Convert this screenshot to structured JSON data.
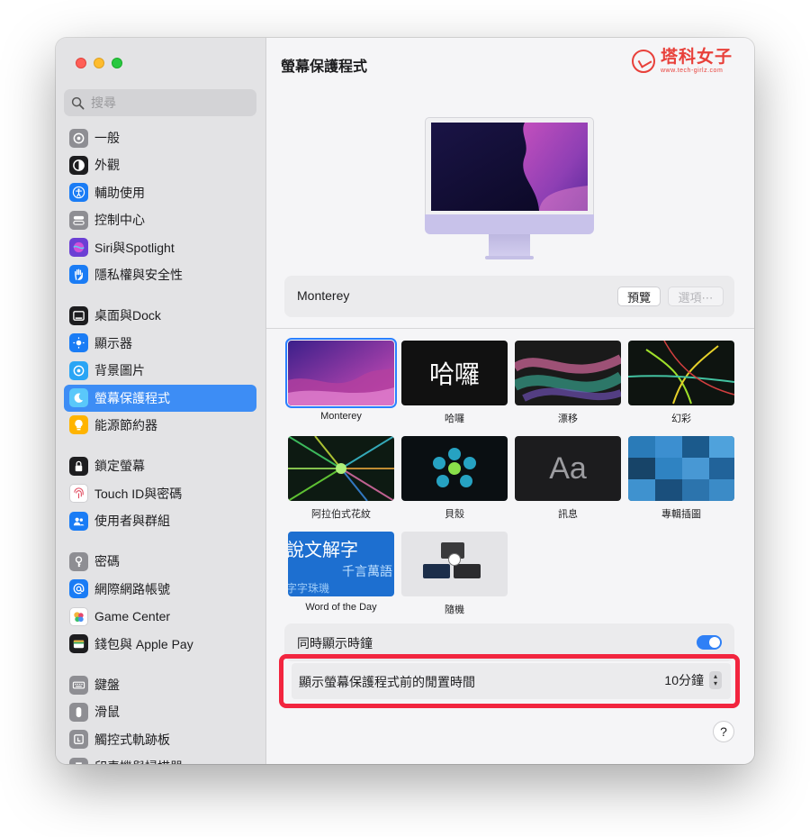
{
  "window": {
    "controls": [
      "close",
      "minimize",
      "zoom"
    ]
  },
  "sidebar": {
    "search_placeholder": "搜尋",
    "groups": [
      [
        {
          "label": "一般",
          "icon": "gear-icon",
          "color": "#8e8e93"
        },
        {
          "label": "外觀",
          "icon": "appearance-icon",
          "color": "#1d1d1f"
        },
        {
          "label": "輔助使用",
          "icon": "accessibility-icon",
          "color": "#1a7cf5"
        },
        {
          "label": "控制中心",
          "icon": "control-center-icon",
          "color": "#8e8e93"
        },
        {
          "label": "Siri與Spotlight",
          "icon": "siri-icon",
          "color": "#6b3fd4"
        },
        {
          "label": "隱私權與安全性",
          "icon": "hand-icon",
          "color": "#1a7cf5"
        }
      ],
      [
        {
          "label": "桌面與Dock",
          "icon": "dock-icon",
          "color": "#1d1d1f"
        },
        {
          "label": "顯示器",
          "icon": "display-icon",
          "color": "#1a7cf5"
        },
        {
          "label": "背景圖片",
          "icon": "wallpaper-icon",
          "color": "#2aa5f5"
        },
        {
          "label": "螢幕保護程式",
          "icon": "screensaver-icon",
          "color": "#5ac8fa",
          "active": true
        },
        {
          "label": "能源節約器",
          "icon": "lightbulb-icon",
          "color": "#ffb400"
        }
      ],
      [
        {
          "label": "鎖定螢幕",
          "icon": "lock-icon",
          "color": "#1d1d1f"
        },
        {
          "label": "Touch ID與密碼",
          "icon": "fingerprint-icon",
          "color": "#ffffff"
        },
        {
          "label": "使用者與群組",
          "icon": "users-icon",
          "color": "#1a7cf5"
        }
      ],
      [
        {
          "label": "密碼",
          "icon": "key-icon",
          "color": "#8e8e93"
        },
        {
          "label": "網際網路帳號",
          "icon": "at-icon",
          "color": "#1a7cf5"
        },
        {
          "label": "Game Center",
          "icon": "game-center-icon",
          "color": "#ffffff"
        },
        {
          "label": "錢包與 Apple Pay",
          "icon": "wallet-icon",
          "color": "#1d1d1f"
        }
      ],
      [
        {
          "label": "鍵盤",
          "icon": "keyboard-icon",
          "color": "#8e8e93"
        },
        {
          "label": "滑鼠",
          "icon": "mouse-icon",
          "color": "#8e8e93"
        },
        {
          "label": "觸控式軌跡板",
          "icon": "trackpad-icon",
          "color": "#8e8e93"
        },
        {
          "label": "印表機與掃描器",
          "icon": "printer-icon",
          "color": "#8e8e93"
        }
      ]
    ]
  },
  "main": {
    "title": "螢幕保護程式",
    "logo": {
      "main": "塔科女子",
      "sub": "www.tech-girlz.com"
    },
    "current": {
      "name": "Monterey",
      "preview_button": "預覽",
      "options_button": "選項⋯"
    },
    "savers": [
      {
        "label": "Monterey",
        "selected": true
      },
      {
        "label": "哈囉",
        "thumb_text": "哈囉"
      },
      {
        "label": "漂移"
      },
      {
        "label": "幻彩"
      },
      {
        "label": "阿拉伯式花紋"
      },
      {
        "label": "貝殼"
      },
      {
        "label": "訊息",
        "thumb_text": "Aa"
      },
      {
        "label": "專輯插圖"
      },
      {
        "label": "Word of the Day",
        "thumb_text_a": "說文解字",
        "thumb_text_b": "千言萬語",
        "thumb_text_c": "字字珠璣"
      },
      {
        "label": "隨機"
      }
    ],
    "show_clock": {
      "label": "同時顯示時鐘",
      "on": true
    },
    "idle_time": {
      "label": "顯示螢幕保護程式前的閒置時間",
      "value": "10分鐘"
    },
    "help_label": "?"
  }
}
